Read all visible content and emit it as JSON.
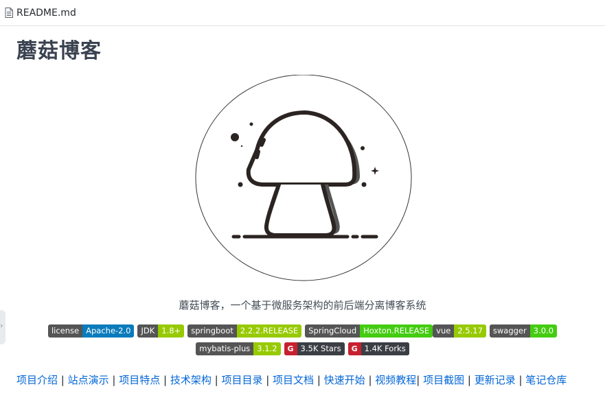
{
  "file": {
    "name": "README.md",
    "icon": "document-icon"
  },
  "readme": {
    "title": "蘑菇博客",
    "logo_icon": "mushroom-logo-icon",
    "description": "蘑菇博客，一个基于微服务架构的前后端分离博客系统"
  },
  "badges_row1": [
    {
      "label": "license",
      "value": "Apache-2.0",
      "color": "#0a7bbb"
    },
    {
      "label": "JDK",
      "value": "1.8+",
      "color": "#97ca00"
    },
    {
      "label": "springboot",
      "value": "2.2.2.RELEASE",
      "color": "#97ca00"
    },
    {
      "label": "SpringCloud",
      "value": "Hoxton.RELEASE",
      "color": "#4c1"
    },
    {
      "label": "vue",
      "value": "2.5.17",
      "color": "#97ca00"
    },
    {
      "label": "swagger",
      "value": "3.0.0",
      "color": "#4c1"
    }
  ],
  "badges_row2": [
    {
      "label": "mybatis-plus",
      "value": "3.1.2",
      "color": "#97ca00"
    }
  ],
  "github_badges": [
    {
      "icon": "gitee-icon",
      "value": "3.5K Stars"
    },
    {
      "icon": "gitee-icon",
      "value": "1.4K Forks"
    }
  ],
  "nav_links": [
    "项目介绍",
    "站点演示",
    "项目特点",
    "技术架构",
    "项目目录",
    "项目文档",
    "快速开始",
    "视频教程",
    "项目截图",
    "更新记录",
    "笔记仓库"
  ],
  "colors": {
    "link": "#0366d6",
    "title": "#3a4250",
    "badge_label_bg": "#555555",
    "gitee_red": "#c7212f"
  }
}
